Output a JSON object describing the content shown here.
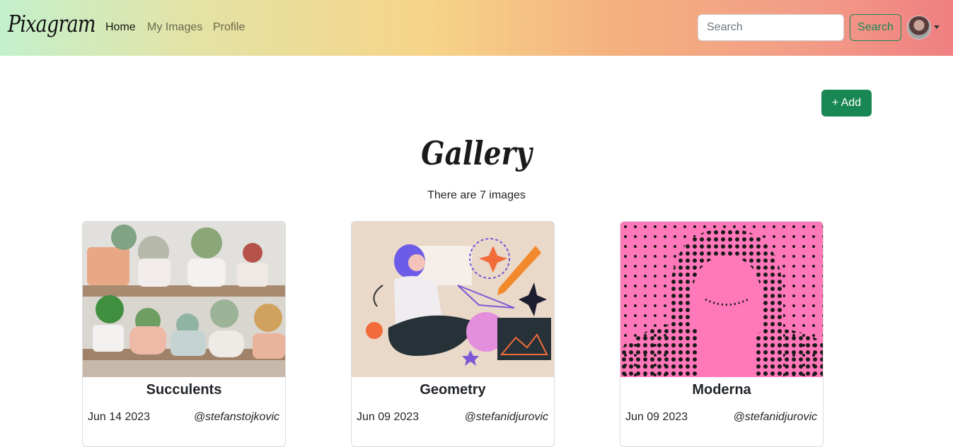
{
  "navbar": {
    "brand": "Pixagram",
    "links": [
      {
        "label": "Home",
        "active": true
      },
      {
        "label": "My Images",
        "active": false
      },
      {
        "label": "Profile",
        "active": false
      }
    ],
    "search_placeholder": "Search",
    "search_button": "Search"
  },
  "add_button": "+ Add",
  "gallery": {
    "title": "Gallery",
    "count_text": "There are 7 images"
  },
  "cards": [
    {
      "title": "Succulents",
      "date": "Jun 14 2023",
      "user": "@stefanstojkovic"
    },
    {
      "title": "Geometry",
      "date": "Jun 09 2023",
      "user": "@stefanidjurovic"
    },
    {
      "title": "Moderna",
      "date": "Jun 09 2023",
      "user": "@stefanidjurovic"
    }
  ],
  "colors": {
    "primary_green": "#198754",
    "moderna_pink": "#ff78b9"
  }
}
